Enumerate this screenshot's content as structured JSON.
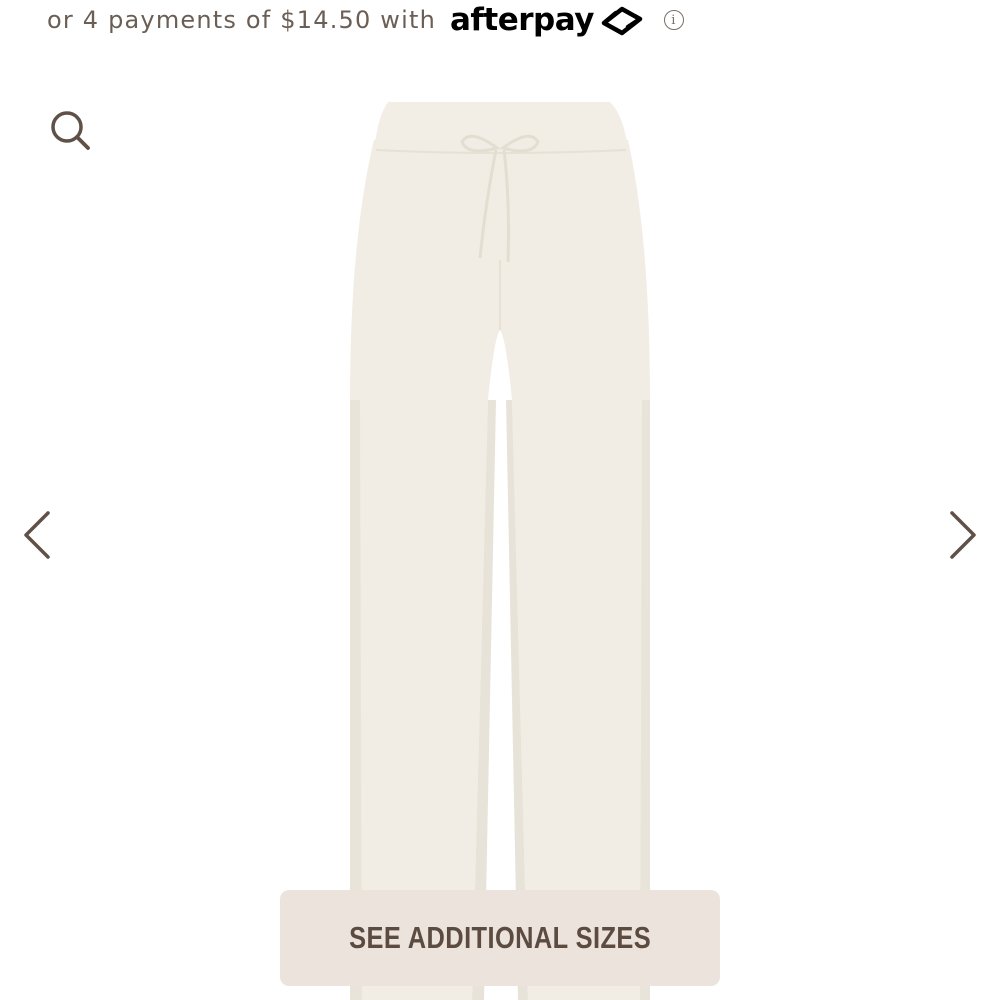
{
  "payment": {
    "text": "or 4 payments of $14.50 with",
    "provider": "afterpay",
    "info_glyph": "i"
  },
  "icons": {
    "search": "search-icon",
    "prev": "chevron-left-icon",
    "next": "chevron-right-icon",
    "afterpay_mark": "afterpay-arrows-icon",
    "info": "info-icon"
  },
  "gallery": {
    "image_alt": "Cream wide-leg knit pants with drawstring waist"
  },
  "cta": {
    "label": "SEE ADDITIONAL SIZES"
  },
  "colors": {
    "text_brown": "#6b5e55",
    "button_bg": "#ece4dc",
    "button_text": "#5b4b40",
    "product": "#f1ede4"
  }
}
